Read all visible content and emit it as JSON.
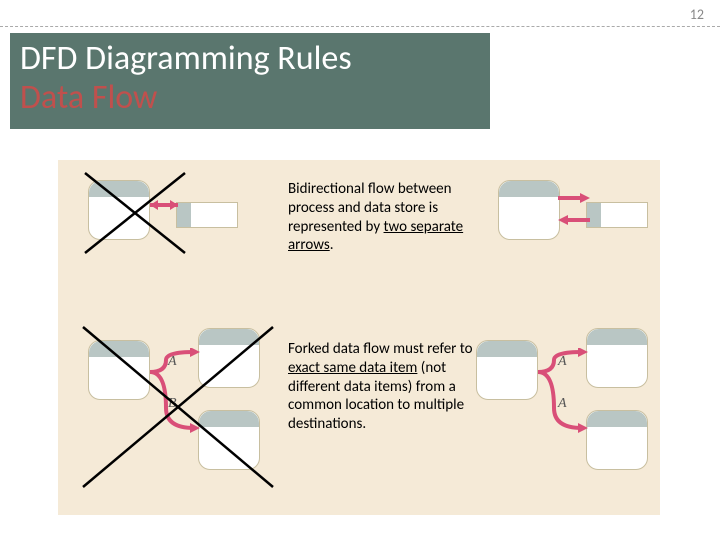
{
  "page_number": "12",
  "title": {
    "line1": "DFD Diagramming Rules",
    "line2": "Data Flow"
  },
  "rules": {
    "rule1": {
      "text_parts": [
        "Bidirectional flow between process and data store is represented by ",
        "two separate arrows",
        "."
      ],
      "underline_index": 1
    },
    "rule2": {
      "text_parts": [
        "Forked data flow must refer to ",
        "exact same data item",
        " (not different data items) from a common location to multiple destinations."
      ],
      "underline_index": 1
    }
  },
  "labels": {
    "wrong_fork_a": "A",
    "wrong_fork_b": "B",
    "right_fork_a": "A",
    "right_fork_b": "A"
  }
}
